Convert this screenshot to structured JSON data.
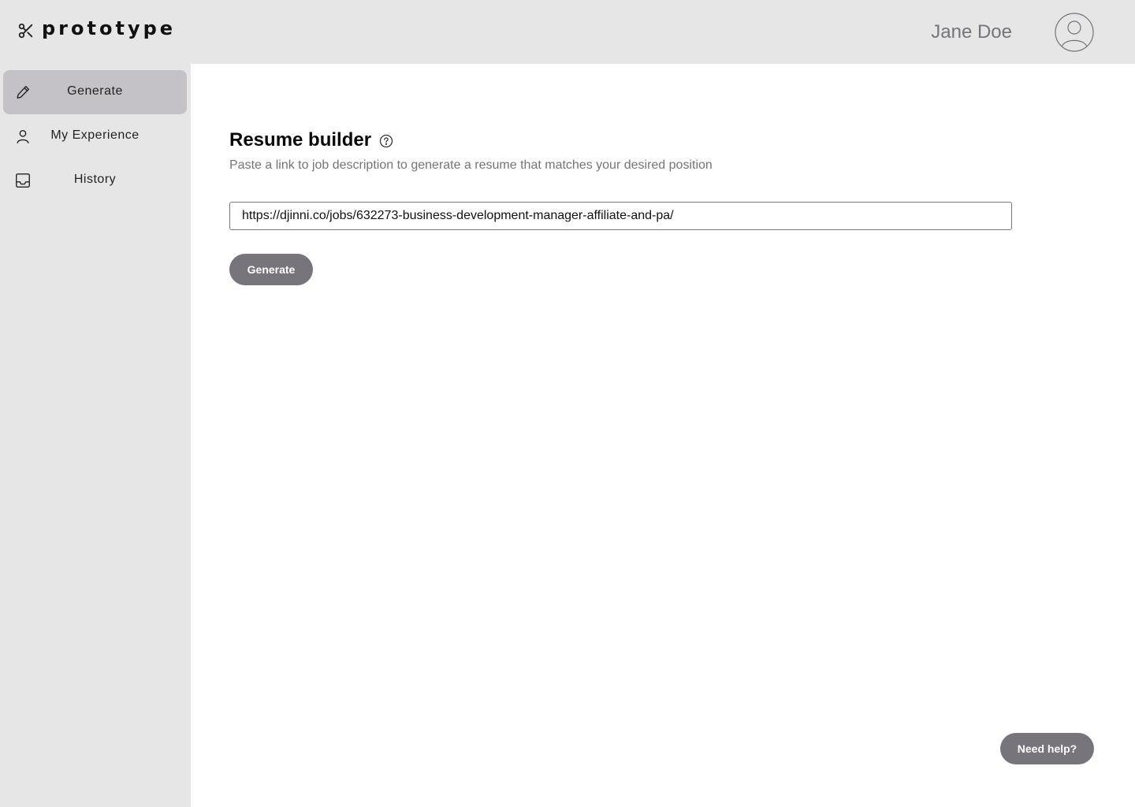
{
  "header": {
    "logo_text": "prototype",
    "logo_icon": "scissors-icon",
    "user_name": "Jane Doe",
    "avatar_icon": "user-circle-icon"
  },
  "sidebar": {
    "items": [
      {
        "label": "Generate",
        "icon": "pencil-icon",
        "active": true
      },
      {
        "label": "My Experience",
        "icon": "person-icon",
        "active": false
      },
      {
        "label": "History",
        "icon": "inbox-icon",
        "active": false
      }
    ]
  },
  "main": {
    "title": "Resume builder",
    "subtitle": "Paste a link to job description to generate a resume that matches your desired position",
    "url_value": "https://djinni.co/jobs/632273-business-development-manager-affiliate-and-pa/",
    "generate_label": "Generate",
    "help_label": "Need help?"
  },
  "colors": {
    "sidebar_bg": "#e6e6e6",
    "active_item_bg": "#c4c2c6",
    "button_bg": "#77747c",
    "muted_text": "#76737b"
  }
}
